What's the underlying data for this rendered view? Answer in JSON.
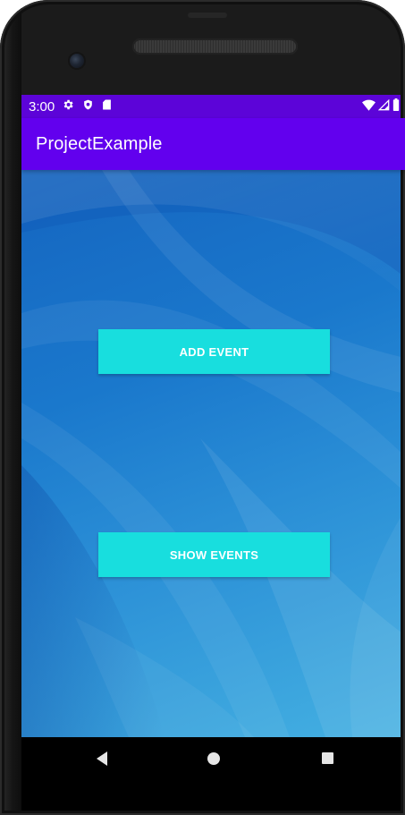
{
  "status_bar": {
    "time": "3:00",
    "left_icons": [
      "gear-icon",
      "shield-icon",
      "sd-card-icon"
    ],
    "right_icons": [
      "wifi-icon",
      "signal-icon",
      "battery-icon"
    ]
  },
  "app_bar": {
    "title": "ProjectExample"
  },
  "main": {
    "add_event_label": "ADD EVENT",
    "show_events_label": "SHOW EVENTS"
  },
  "navigation_bar": {
    "buttons": [
      "back-icon",
      "home-icon",
      "recents-icon"
    ]
  },
  "colors": {
    "status_bar": "#5c04d8",
    "app_bar": "#6200ee",
    "button": "#18dede",
    "button_text": "#ffffff",
    "nav_bar": "#000000"
  }
}
